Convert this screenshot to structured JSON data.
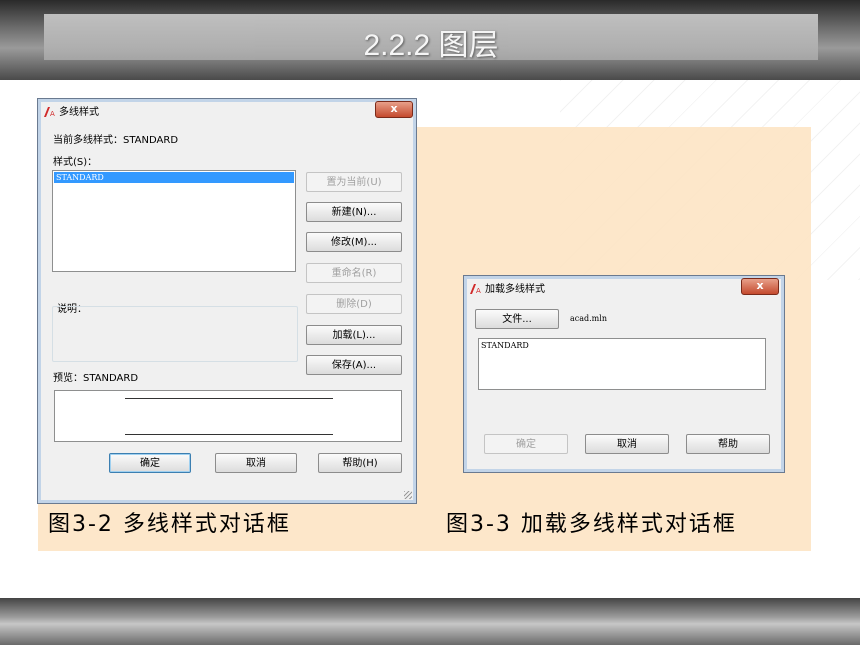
{
  "slide": {
    "title": "2.2.2  图层"
  },
  "dialog_multiline": {
    "title": "多线样式",
    "close": "x",
    "current_style": "当前多线样式：STANDARD",
    "styles_label": "样式(S)：",
    "styles": [
      "STANDARD"
    ],
    "description_label": "说明：",
    "preview_label": "预览：STANDARD",
    "buttons": {
      "set_current": "置为当前(U)",
      "new": "新建(N)...",
      "modify": "修改(M)...",
      "rename": "重命名(R)",
      "delete": "删除(D)",
      "load": "加载(L)...",
      "save": "保存(A)...",
      "ok": "确定",
      "cancel": "取消",
      "help": "帮助(H)"
    }
  },
  "dialog_load": {
    "title": "加载多线样式",
    "close": "x",
    "file_button": "文件...",
    "file_name": "acad.mln",
    "styles": [
      "STANDARD"
    ],
    "buttons": {
      "ok": "确定",
      "cancel": "取消",
      "help": "帮助"
    }
  },
  "captions": {
    "left": "图3-2  多线样式对话框",
    "right": "图3-3  加载多线样式对话框"
  },
  "colors": {
    "selection": "#3399ff",
    "peach": "#fde4c4",
    "close": "#c44a2e"
  }
}
